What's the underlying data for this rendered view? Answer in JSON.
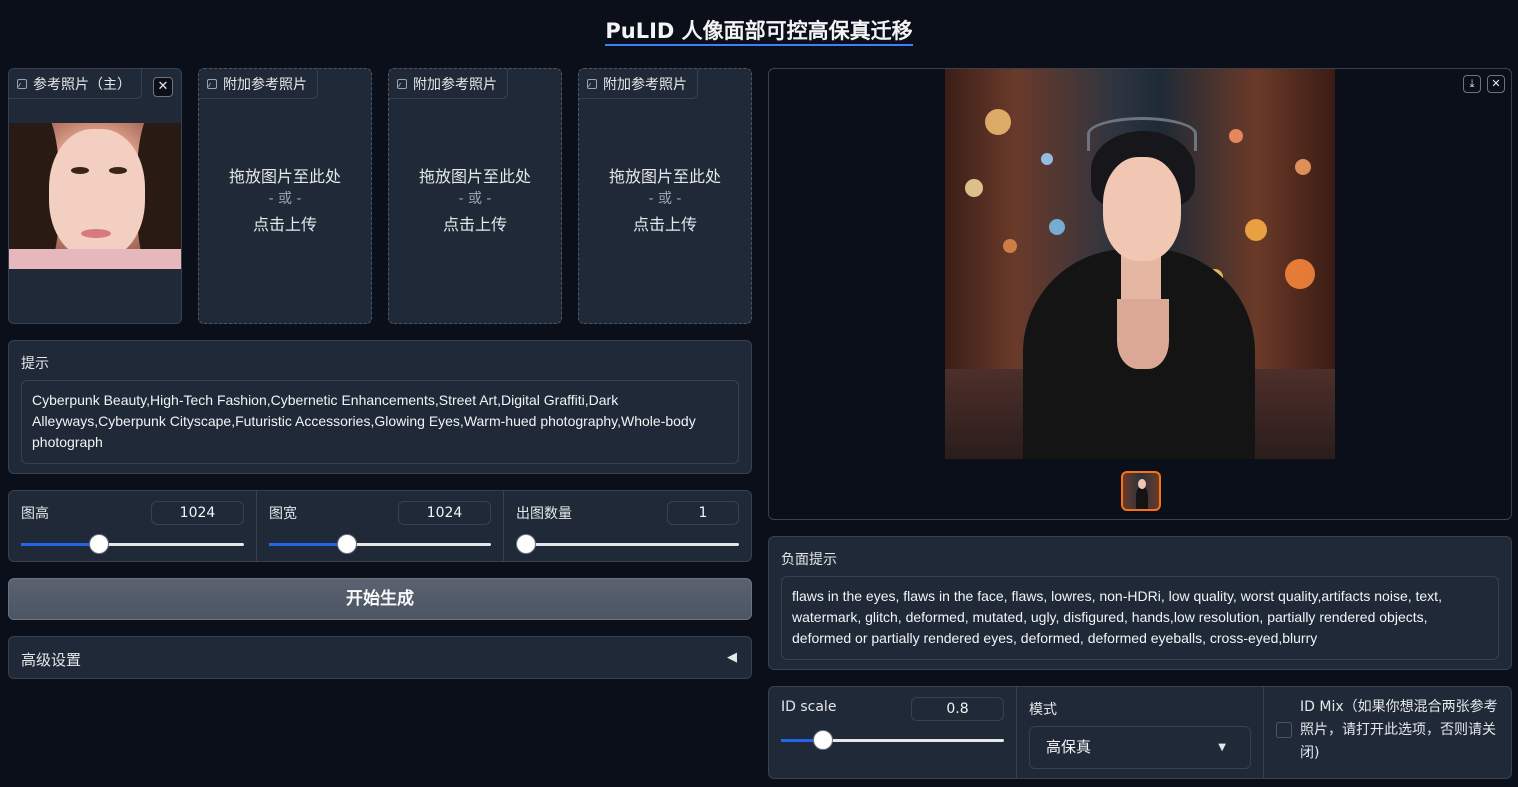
{
  "page": {
    "title": "PuLID 人像面部可控高保真迁移"
  },
  "reference_images": [
    {
      "label": "参考照片（主）",
      "has_image": true
    },
    {
      "label": "附加参考照片",
      "drop_text": "拖放图片至此处",
      "or_text": "- 或 -",
      "click_text": "点击上传"
    },
    {
      "label": "附加参考照片",
      "drop_text": "拖放图片至此处",
      "or_text": "- 或 -",
      "click_text": "点击上传"
    },
    {
      "label": "附加参考照片",
      "drop_text": "拖放图片至此处",
      "or_text": "- 或 -",
      "click_text": "点击上传"
    }
  ],
  "prompt": {
    "label": "提示",
    "value": "Cyberpunk Beauty,High-Tech Fashion,Cybernetic Enhancements,Street Art,Digital Graffiti,Dark Alleyways,Cyberpunk Cityscape,Futuristic Accessories,Glowing Eyes,Warm-hued photography,Whole-body photograph"
  },
  "sliders": {
    "height": {
      "label": "图高",
      "value": "1024",
      "fraction": 0.35
    },
    "width": {
      "label": "图宽",
      "value": "1024",
      "fraction": 0.35
    },
    "count": {
      "label": "出图数量",
      "value": "1",
      "fraction": 0.0
    }
  },
  "generate_button": "开始生成",
  "advanced": {
    "label": "高级设置",
    "toggle_icon": "◀"
  },
  "output": {
    "download_icon": "⤓",
    "close_icon": "✕"
  },
  "negative_prompt": {
    "label": "负面提示",
    "value": "flaws in the eyes, flaws in the face, flaws, lowres, non-HDRi, low quality, worst quality,artifacts noise, text, watermark, glitch, deformed, mutated, ugly, disfigured, hands,low resolution, partially rendered objects, deformed or partially rendered eyes, deformed, deformed eyeballs, cross-eyed,blurry"
  },
  "id_scale": {
    "label": "ID scale",
    "value": "0.8",
    "fraction": 0.19
  },
  "mode": {
    "label": "模式",
    "selected": "高保真"
  },
  "id_mix": {
    "label": "ID Mix（如果你想混合两张参考照片，请打开此选项，否则请关闭)",
    "checked": false
  },
  "colors": {
    "accent": "#2563eb",
    "selected_thumb": "#f97316",
    "background": "#0b0f19",
    "panel": "#1f2937"
  }
}
